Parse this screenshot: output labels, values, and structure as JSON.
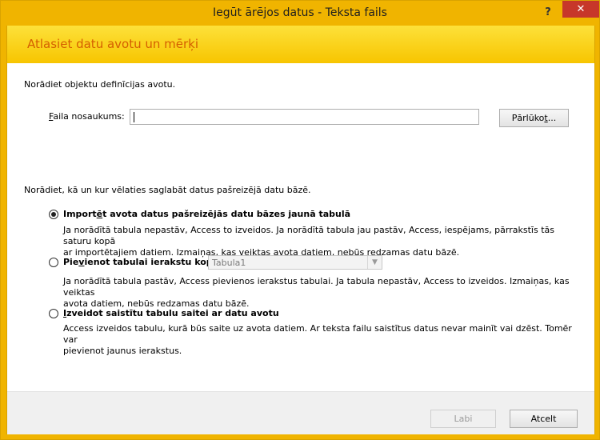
{
  "window": {
    "title": "Iegūt ārējos datus - Teksta fails",
    "help_label": "?",
    "close_label": "✕"
  },
  "banner": {
    "title": "Atlasiet datu avotu un mērķi"
  },
  "source": {
    "heading": "Norādiet objektu definīcijas avotu.",
    "file_label_prefix": "",
    "file_label_hotkey": "F",
    "file_label_rest": "aila nosaukums:",
    "file_value": "",
    "browse_pre": "Pārlūko",
    "browse_hotkey": "t",
    "browse_post": "..."
  },
  "dest": {
    "heading": "Norādiet, kā un kur vēlaties saglabāt datus pašreizējā datu bāzē.",
    "options": [
      {
        "pre": "Import",
        "hotkey": "ē",
        "post": "t avota datus pašreizējās datu bāzes jaunā tabulā",
        "selected": true,
        "desc_line1": "Ja norādītā tabula nepastāv, Access to izveidos. Ja norādītā tabula jau pastāv, Access, iespējams, pārrakstīs tās saturu kopā",
        "desc_line2": "ar importētajiem datiem. Izmaiņas, kas veiktas avota datiem, nebūs redzamas datu bāzē."
      },
      {
        "pre": "Pie",
        "hotkey": "v",
        "post": "ienot tabulai ierakstu kopiju:",
        "selected": false,
        "table_value": "Tabula1",
        "desc_line1": "Ja norādītā tabula pastāv, Access pievienos ierakstus tabulai. Ja tabula nepastāv, Access to izveidos. Izmaiņas, kas veiktas",
        "desc_line2": "avota datiem, nebūs redzamas datu bāzē."
      },
      {
        "pre": "",
        "hotkey": "I",
        "post": "zveidot saistītu tabulu saitei ar datu avotu",
        "selected": false,
        "desc_line1": "Access izveidos tabulu, kurā būs saite uz avota datiem. Ar teksta failu saistītus datus nevar mainīt vai dzēst. Tomēr var",
        "desc_line2": "pievienot jaunus ierakstus."
      }
    ]
  },
  "footer": {
    "next_label": "Labi",
    "cancel_label": "Atcelt"
  },
  "colors": {
    "accent": "#f0b400",
    "banner_text": "#d55f00",
    "close_button": "#c7372a"
  }
}
